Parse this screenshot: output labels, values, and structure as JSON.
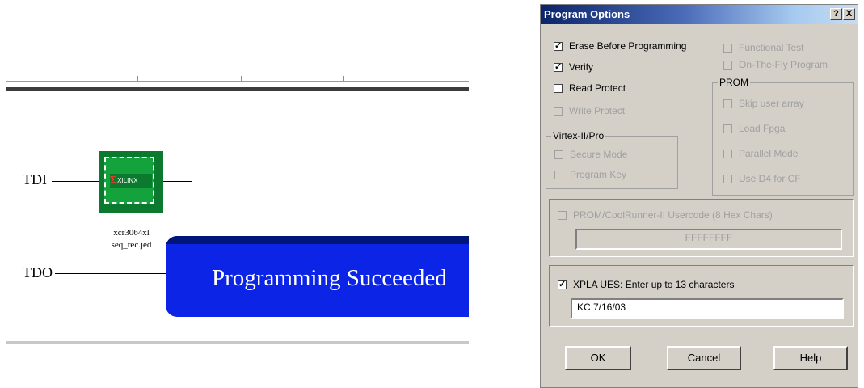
{
  "chain": {
    "tdi_label": "TDI",
    "tdo_label": "TDO",
    "device_brand": "XILINX",
    "device_part": "xcr3064xl",
    "device_file": "seq_rec.jed",
    "status_message": "Programming Succeeded"
  },
  "dialog": {
    "title": "Program Options",
    "help_button": "?",
    "close_button": "X",
    "options": {
      "erase_before_programming": {
        "label": "Erase Before Programming",
        "checked": true
      },
      "verify": {
        "label": "Verify",
        "checked": true
      },
      "read_protect": {
        "label": "Read Protect",
        "checked": false
      },
      "write_protect": {
        "label": "Write Protect",
        "checked": false
      },
      "functional_test": {
        "label": "Functional Test",
        "checked": false
      },
      "on_the_fly_program": {
        "label": "On-The-Fly Program",
        "checked": false
      }
    },
    "prom_group": {
      "label": "PROM",
      "skip_user_array": "Skip user array",
      "load_fpga": "Load Fpga",
      "parallel_mode": "Parallel Mode",
      "use_d4_for_cf": "Use D4 for CF"
    },
    "virtex_group": {
      "label": "Virtex-II/Pro",
      "secure_mode": "Secure Mode",
      "program_key": "Program Key"
    },
    "prom_usercode": {
      "label": "PROM/CoolRunner-II Usercode (8 Hex Chars)",
      "value": "FFFFFFFF",
      "checked": false
    },
    "xpla_ues": {
      "label": "XPLA UES: Enter up to  13 characters",
      "value": "KC 7/16/03",
      "checked": true
    },
    "buttons": {
      "ok": "OK",
      "cancel": "Cancel",
      "help": "Help"
    }
  }
}
